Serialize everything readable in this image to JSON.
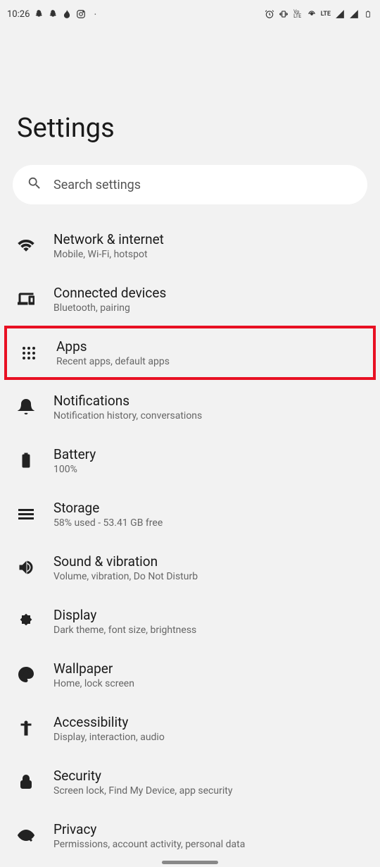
{
  "statusBar": {
    "time": "10:26",
    "lte": "LTE"
  },
  "pageTitle": "Settings",
  "search": {
    "placeholder": "Search settings"
  },
  "items": [
    {
      "title": "Network & internet",
      "subtitle": "Mobile, Wi-Fi, hotspot"
    },
    {
      "title": "Connected devices",
      "subtitle": "Bluetooth, pairing"
    },
    {
      "title": "Apps",
      "subtitle": "Recent apps, default apps"
    },
    {
      "title": "Notifications",
      "subtitle": "Notification history, conversations"
    },
    {
      "title": "Battery",
      "subtitle": "100%"
    },
    {
      "title": "Storage",
      "subtitle": "58% used - 53.41 GB free"
    },
    {
      "title": "Sound & vibration",
      "subtitle": "Volume, vibration, Do Not Disturb"
    },
    {
      "title": "Display",
      "subtitle": "Dark theme, font size, brightness"
    },
    {
      "title": "Wallpaper",
      "subtitle": "Home, lock screen"
    },
    {
      "title": "Accessibility",
      "subtitle": "Display, interaction, audio"
    },
    {
      "title": "Security",
      "subtitle": "Screen lock, Find My Device, app security"
    },
    {
      "title": "Privacy",
      "subtitle": "Permissions, account activity, personal data"
    }
  ]
}
